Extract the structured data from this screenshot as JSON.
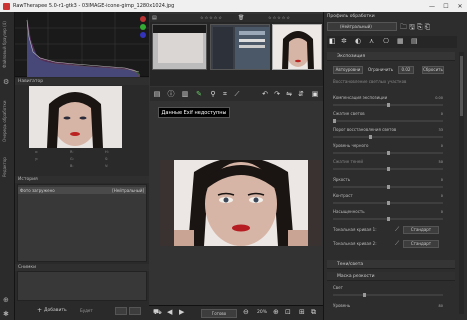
{
  "window": {
    "title": "RawTherapee 5.0-r1-gtk3 - 03IMAGE-icone-gimp_1280x1024.jpg",
    "minimize": "—",
    "maximize": "☐",
    "close": "✕"
  },
  "left_strip": {
    "tabs": [
      "Файловый браузер (4)",
      "Очередь обработки",
      "Редактор"
    ]
  },
  "left": {
    "navigator_title": "Навигатор",
    "history_title": "История",
    "history_item": "Фото загружено",
    "history_item_value": "[Нейтральный]",
    "snapshots_title": "Снимки",
    "add_label": "Добавить",
    "info_labels": [
      "x:",
      "y:",
      "R:",
      "G:",
      "B:",
      "H:",
      "S:",
      "V:"
    ],
    "zoom_label": "Будет"
  },
  "center": {
    "tooltip": "Данные Exif недоступны",
    "bottom_button": "Готово",
    "zoom_value": "20%"
  },
  "right": {
    "profile_title": "Профиль обработки",
    "profile_value": "(Нейтральный)",
    "exposure_title": "Экспозиция",
    "auto_levels": "Автоуровни",
    "clip": "Ограничить",
    "clip_value": "0.02",
    "reset": "Сбросить",
    "highlight_reconstruction": "Восстановление светлых участков",
    "rows": [
      {
        "label": "Компенсация экспозиции",
        "value": "0.00"
      },
      {
        "label": "Сжатие светов",
        "value": "0"
      },
      {
        "label": "Порог восстановления светов",
        "value": "33"
      },
      {
        "label": "Уровень черного",
        "value": "0"
      },
      {
        "label": "Сжатие теней",
        "value": "50"
      },
      {
        "label": "Яркость",
        "value": "0"
      },
      {
        "label": "Контраст",
        "value": "0"
      },
      {
        "label": "Насыщенность",
        "value": "0"
      }
    ],
    "curve1": "Тональная кривая 1:",
    "curve2": "Тональная кривая 2:",
    "curve_mode": "Стандарт",
    "shadows_highlights": "Тени/света",
    "sharpen": "Маска резкости",
    "lightness": "Свет",
    "level": "Уровень",
    "level_value": "80"
  },
  "colors": {
    "bg": "#1e1e1e",
    "panel": "#2d2d2d",
    "accent_red": "#cc3333"
  }
}
